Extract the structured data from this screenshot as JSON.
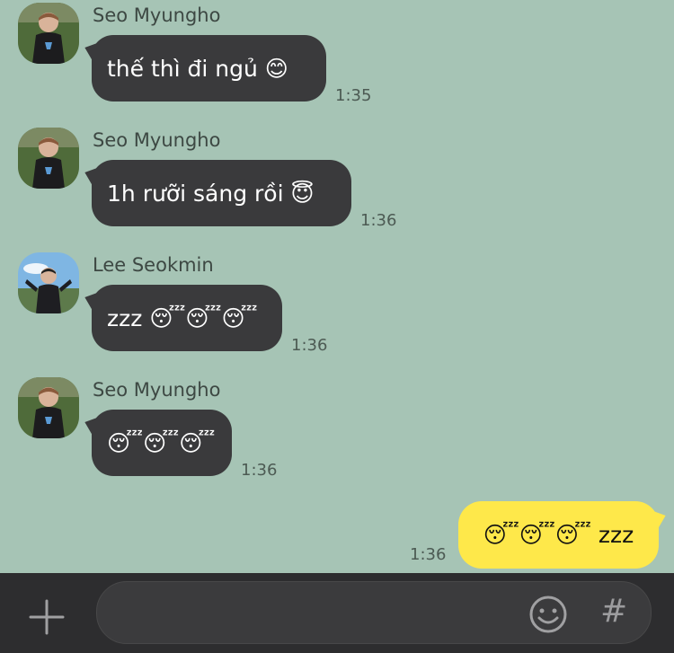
{
  "messages": [
    {
      "sender": "Seo Myungho",
      "text": "thế thì đi ngủ 😊",
      "time": "1:35",
      "avatar": "person-black-tshirt"
    },
    {
      "sender": "Seo Myungho",
      "text": "1h rưỡi sáng rồi 😇",
      "time": "1:36",
      "avatar": "person-black-tshirt"
    },
    {
      "sender": "Lee Seokmin",
      "text": "zzz 😴😴😴",
      "time": "1:36",
      "avatar": "person-outdoor-sky"
    },
    {
      "sender": "Seo Myungho",
      "text": "😴😴😴",
      "time": "1:36",
      "avatar": "person-black-tshirt"
    }
  ],
  "my_message": {
    "text": "😴😴😴 zzz",
    "time": "1:36"
  },
  "input": {
    "placeholder": ""
  },
  "colors": {
    "background": "#a6c4b5",
    "incoming_bubble": "#3a3a3c",
    "outgoing_bubble": "#fee84a",
    "input_bar": "#2d2d2f"
  },
  "icons": [
    "plus-icon",
    "emoji-icon",
    "hashtag-icon"
  ]
}
